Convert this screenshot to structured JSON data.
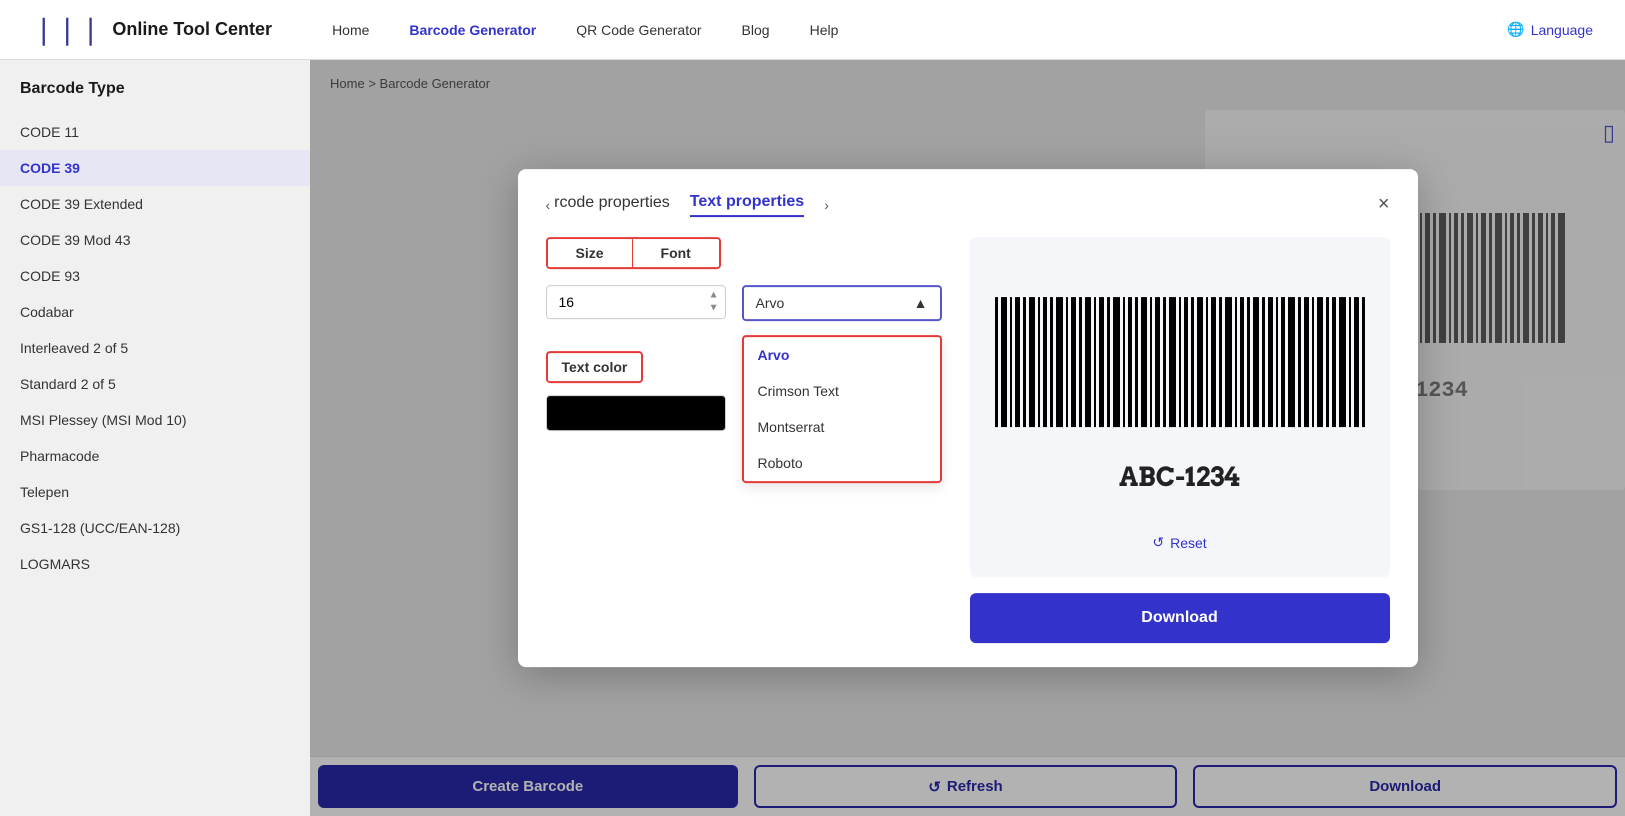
{
  "header": {
    "logo_text": "Online Tool Center",
    "nav_items": [
      {
        "label": "Home",
        "active": false
      },
      {
        "label": "Barcode Generator",
        "active": true
      },
      {
        "label": "QR Code Generator",
        "active": false
      },
      {
        "label": "Blog",
        "active": false
      },
      {
        "label": "Help",
        "active": false
      }
    ],
    "language_label": "Language"
  },
  "sidebar": {
    "title": "Barcode Type",
    "items": [
      {
        "label": "CODE 11",
        "active": false
      },
      {
        "label": "CODE 39",
        "active": true
      },
      {
        "label": "CODE 39 Extended",
        "active": false
      },
      {
        "label": "CODE 39 Mod 43",
        "active": false
      },
      {
        "label": "CODE 93",
        "active": false
      },
      {
        "label": "Codabar",
        "active": false
      },
      {
        "label": "Interleaved 2 of 5",
        "active": false
      },
      {
        "label": "Standard 2 of 5",
        "active": false
      },
      {
        "label": "MSI Plessey (MSI Mod 10)",
        "active": false
      },
      {
        "label": "Pharmacode",
        "active": false
      },
      {
        "label": "Telepen",
        "active": false
      },
      {
        "label": "GS1-128 (UCC/EAN-128)",
        "active": false
      },
      {
        "label": "LOGMARS",
        "active": false
      }
    ]
  },
  "breadcrumb": {
    "home": "Home",
    "separator": ">",
    "current": "Barcode Generator"
  },
  "modal": {
    "tab_prev": "‹",
    "tab_next": "›",
    "tab_inactive_label": "rcode properties",
    "tab_active_label": "Text properties",
    "close_label": "×",
    "size_tab_label": "Size",
    "font_tab_label": "Font",
    "size_value": "16",
    "text_color_label": "Text color",
    "font_selected": "Arvo",
    "font_options": [
      {
        "label": "Arvo",
        "selected": true
      },
      {
        "label": "Crimson Text",
        "selected": false
      },
      {
        "label": "Montserrat",
        "selected": false
      },
      {
        "label": "Roboto",
        "selected": false
      }
    ],
    "barcode_value": "ABC-1234",
    "reset_label": "Reset",
    "download_label": "Download"
  },
  "bottom_buttons": {
    "create_label": "Create Barcode",
    "refresh_label": "Refresh",
    "download_label": "Download"
  }
}
